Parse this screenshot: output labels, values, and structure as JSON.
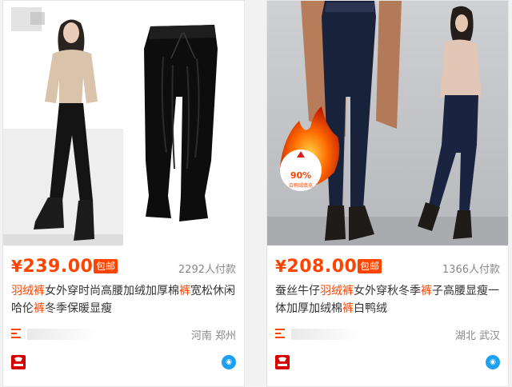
{
  "products": [
    {
      "currency": "¥",
      "price": "239.00",
      "badge": "包邮",
      "sales": "2292人付款",
      "title_segments": [
        {
          "text": "羽绒裤",
          "hl": true
        },
        {
          "text": "女外穿时尚高腰加绒加厚棉",
          "hl": false
        },
        {
          "text": "裤",
          "hl": true
        },
        {
          "text": "宽松休闲哈伦",
          "hl": false
        },
        {
          "text": "裤",
          "hl": true
        },
        {
          "text": "冬季保暖显瘦",
          "hl": false
        }
      ],
      "location": "河南 郑州"
    },
    {
      "currency": "¥",
      "price": "208.00",
      "badge": "包邮",
      "sales": "1366人付款",
      "title_segments": [
        {
          "text": "蚕丝牛仔",
          "hl": false
        },
        {
          "text": "羽绒裤",
          "hl": true
        },
        {
          "text": "女外穿秋冬季",
          "hl": false
        },
        {
          "text": "裤",
          "hl": true
        },
        {
          "text": "子高腰显瘦一体加厚加绒棉",
          "hl": false
        },
        {
          "text": "裤",
          "hl": true
        },
        {
          "text": "白鸭绒",
          "hl": false
        }
      ],
      "location": "湖北 武汉",
      "image_badge": {
        "percent": "90%",
        "text": "白鸭绒填充"
      }
    }
  ],
  "colors": {
    "accent": "#ff4400",
    "muted": "#888888",
    "text": "#333333",
    "store_logo": "#d60000",
    "chat_icon": "#1ca0f2"
  },
  "icons": {
    "shop": "shop-list-icon",
    "store_logo": "store-logo-icon",
    "chat": "wangwang-chat-icon"
  }
}
